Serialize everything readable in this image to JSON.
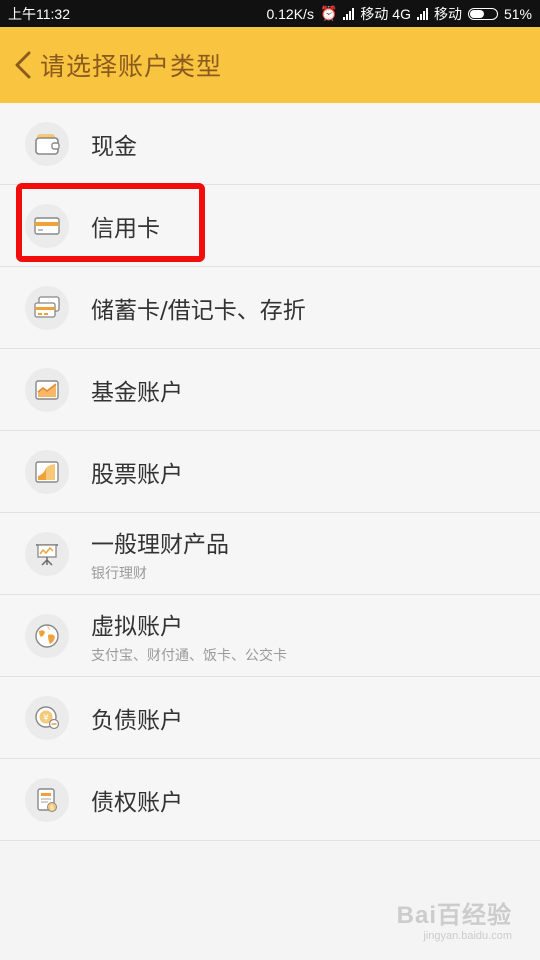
{
  "status_bar": {
    "time": "上午11:32",
    "speed": "0.12K/s",
    "carrier1": "移动 4G",
    "carrier2": "移动",
    "battery": "51%",
    "battery_level": 0.51
  },
  "header": {
    "title": "请选择账户类型",
    "back_icon": "chevron-left-icon"
  },
  "accounts": [
    {
      "label": "现金",
      "icon": "wallet-icon"
    },
    {
      "label": "信用卡",
      "icon": "credit-card-icon"
    },
    {
      "label": "储蓄卡/借记卡、存折",
      "icon": "debit-cards-icon"
    },
    {
      "label": "基金账户",
      "icon": "fund-chart-icon"
    },
    {
      "label": "股票账户",
      "icon": "stock-chart-icon"
    },
    {
      "label": "一般理财产品",
      "sub": "银行理财",
      "icon": "presentation-icon"
    },
    {
      "label": "虚拟账户",
      "sub": "支付宝、财付通、饭卡、公交卡",
      "icon": "globe-icon"
    },
    {
      "label": "负债账户",
      "icon": "debt-coin-icon"
    },
    {
      "label": "债权账户",
      "icon": "receivable-doc-icon"
    }
  ],
  "colors": {
    "header_bg": "#f9c440",
    "title_color": "#8a5a1f",
    "icon_orange": "#f0a23a",
    "highlight": "#f20d0d"
  },
  "watermark": {
    "text": "Bai百经验",
    "url": "jingyan.baidu.com"
  }
}
